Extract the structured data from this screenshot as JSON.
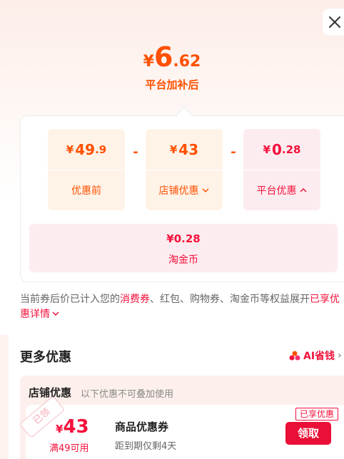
{
  "close_label": "Close",
  "price": {
    "currency": "¥",
    "integer": "6",
    "decimal": ".62",
    "label": "平台加补后"
  },
  "breakdown": {
    "before": {
      "currency": "¥",
      "integer": "49",
      "decimal": ".9",
      "label": "优惠前"
    },
    "minus": "-",
    "store": {
      "currency": "¥",
      "integer": "43",
      "label": "店铺优惠",
      "caret": "∨"
    },
    "platform": {
      "currency": "¥",
      "integer": "0",
      "decimal": ".28",
      "label": "平台优惠",
      "caret": "∧"
    },
    "coin": {
      "value": "¥0.28",
      "label": "淘金币"
    }
  },
  "note": {
    "part1": "当前券后价已计入您的",
    "link1": "消费券",
    "part2": "、红包、购物券、淘金币等权益展开",
    "link2": "已享优惠详情",
    "caret": "∨"
  },
  "more": {
    "title": "更多优惠",
    "ai_label": "AI省钱",
    "ai_caret": "›"
  },
  "store_section": {
    "title": "店铺优惠",
    "subtitle": "以下优惠不可叠加使用"
  },
  "coupon": {
    "claimed": "已领",
    "currency": "¥",
    "amount": "43",
    "condition": "满49可用",
    "name": "商品优惠券",
    "expiry": "距到期仅剩4天",
    "tag": "已享优惠",
    "button": "领取"
  },
  "colors": {
    "accent_orange": "#ff5000",
    "accent_red": "#f5113c",
    "button_red": "#ea0f36"
  }
}
